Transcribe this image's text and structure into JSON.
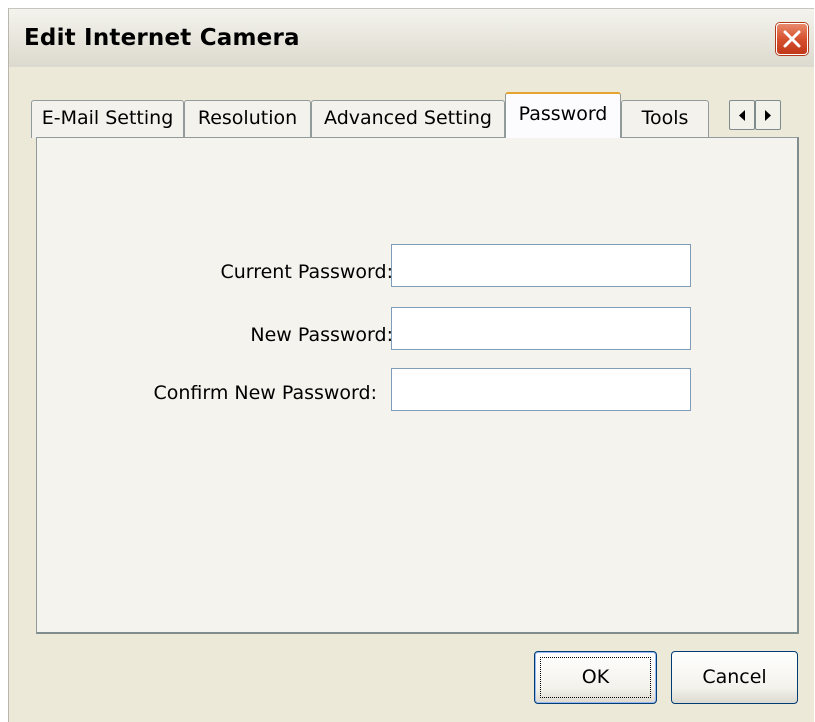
{
  "window": {
    "title": "Edit Internet Camera"
  },
  "tabs": [
    {
      "label": "E-Mail Setting",
      "active": false
    },
    {
      "label": "Resolution",
      "active": false
    },
    {
      "label": "Advanced Setting",
      "active": false
    },
    {
      "label": "Password",
      "active": true
    },
    {
      "label": "Tools",
      "active": false
    }
  ],
  "form": {
    "current_password_label": "Current Password:",
    "current_password_value": "",
    "new_password_label": "New Password:",
    "new_password_value": "",
    "confirm_password_label": "Confirm New Password:",
    "confirm_password_value": ""
  },
  "buttons": {
    "ok": "OK",
    "cancel": "Cancel"
  },
  "icons": {
    "close": "close-icon",
    "tab_scroll_left": "arrow-left-icon",
    "tab_scroll_right": "arrow-right-icon"
  },
  "colors": {
    "close_button": "#d6512e",
    "active_tab_accent": "#e5a32f",
    "window_background": "#ece9d8"
  }
}
